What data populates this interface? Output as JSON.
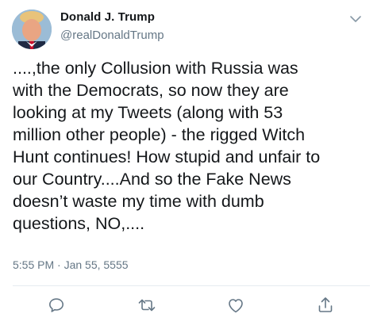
{
  "tweet": {
    "display_name": "Donald J. Trump",
    "handle": "@realDonaldTrump",
    "text_lines": [
      "....,the only Collusion with Russia was",
      "with the Democrats, so now they are",
      "looking at my Tweets (along with 53",
      "million other people) - the rigged Witch",
      "Hunt continues! How stupid and unfair to",
      "our Country....And so the Fake News",
      "doesn’t waste my time with dumb",
      "questions, NO,...."
    ],
    "timestamp": "5:55 PM · Jan 55, 5555"
  },
  "icons": {
    "more": "chevron-down-icon",
    "reply": "reply-icon",
    "retweet": "retweet-icon",
    "like": "heart-icon",
    "share": "share-icon"
  },
  "colors": {
    "text": "#14171a",
    "secondary": "#657786",
    "icon": "#657786",
    "divider": "#e6ecf0"
  }
}
